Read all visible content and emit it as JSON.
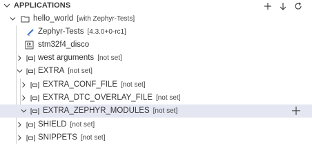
{
  "header": {
    "title": "APPLICATIONS",
    "actions": [
      "add-icon",
      "arrow-down-icon",
      "refresh-icon"
    ]
  },
  "tree": {
    "app": {
      "label": "hello_world",
      "desc": "[with Zephyr-Tests]"
    },
    "sdk": {
      "label": "Zephyr-Tests",
      "desc": "[4.3.0+0-rc1]"
    },
    "board": {
      "label": "stm32f4_disco"
    },
    "west_arguments": {
      "label": "west arguments",
      "desc": "[not set]"
    },
    "extra": {
      "label": "EXTRA",
      "desc": "[not set]"
    },
    "extra_conf_file": {
      "label": "EXTRA_CONF_FILE",
      "desc": "[not set]"
    },
    "extra_dtc_overlay_file": {
      "label": "EXTRA_DTC_OVERLAY_FILE",
      "desc": "[not set]"
    },
    "extra_zephyr_modules": {
      "label": "EXTRA_ZEPHYR_MODULES",
      "desc": "[not set]"
    },
    "shield": {
      "label": "SHIELD",
      "desc": "[not set]"
    },
    "snippets": {
      "label": "SNIPPETS",
      "desc": "[not set]"
    }
  },
  "colors": {
    "selection": "#e4e6f1",
    "sdk_icon": "#3b6fd4"
  }
}
